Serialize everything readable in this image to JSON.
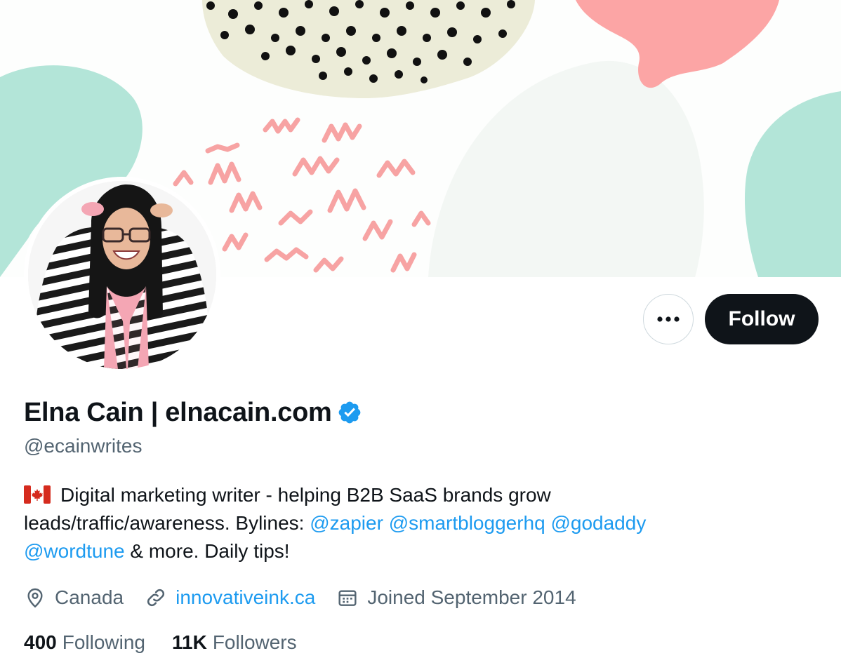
{
  "profile": {
    "display_name": "Elna Cain | elnacain.com",
    "handle": "@ecainwrites",
    "verified": true
  },
  "actions": {
    "more_label": "···",
    "follow_label": "Follow"
  },
  "bio": {
    "flag": "canada-flag-icon",
    "text_1": "Digital marketing writer - helping B2B SaaS brands grow leads/traffic/awareness. Bylines: ",
    "mentions": [
      "@zapier",
      "@smartbloggerhq",
      "@godaddy",
      "@wordtune"
    ],
    "text_2": " & more. Daily tips!"
  },
  "meta": {
    "location": "Canada",
    "website": "innovativeink.ca",
    "joined": "Joined September 2014"
  },
  "stats": {
    "following_count": "400",
    "following_label": "Following",
    "followers_count": "11K",
    "followers_label": "Followers"
  },
  "colors": {
    "accent": "#1d9bf0",
    "text": "#0f1419",
    "muted": "#536471",
    "follow_bg": "#0f1419",
    "banner_mint": "#b3e5d8",
    "banner_pink": "#fca5a5",
    "banner_cream": "#ececd8"
  }
}
